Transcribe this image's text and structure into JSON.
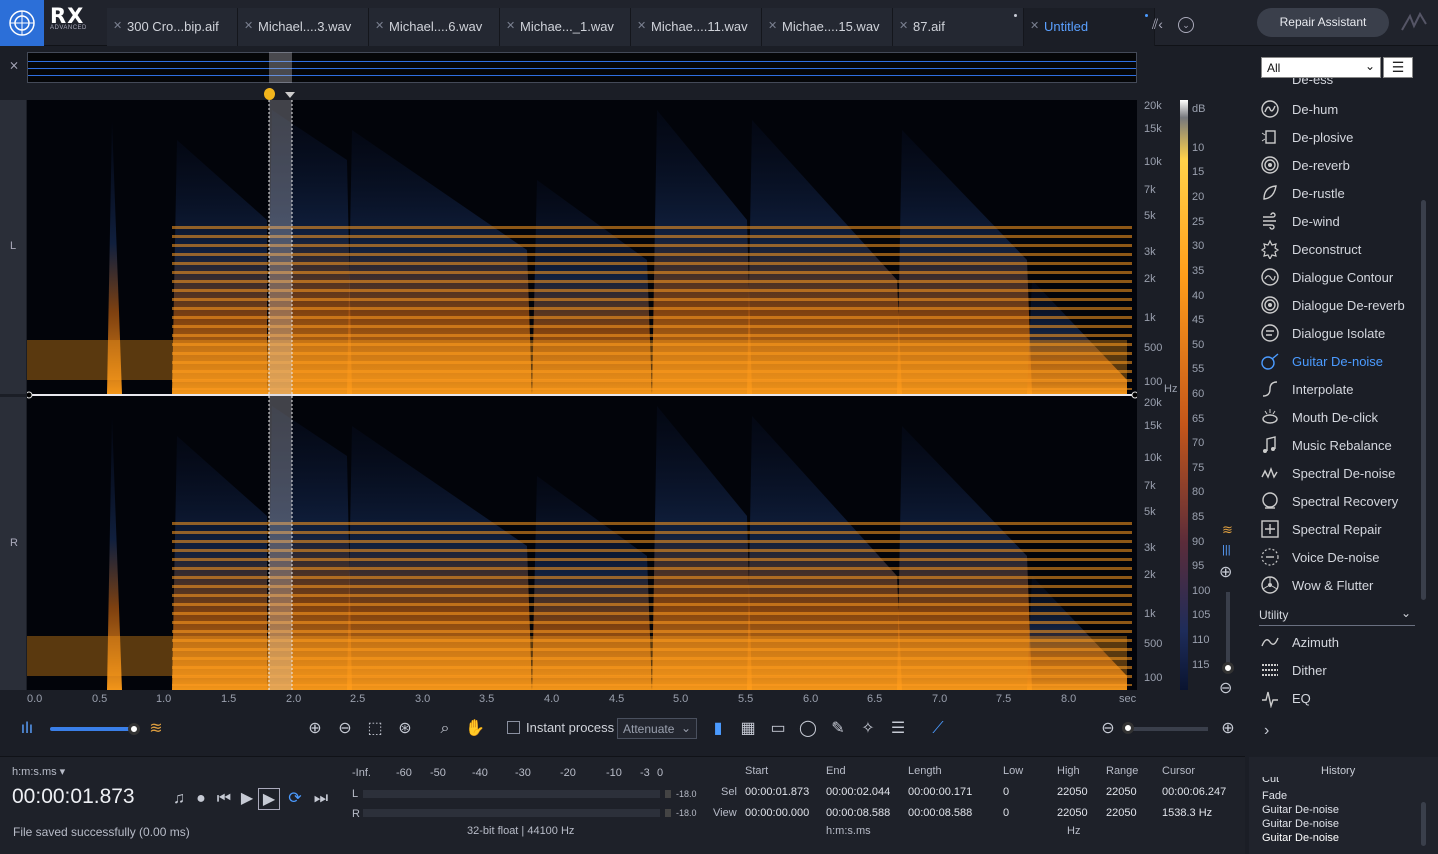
{
  "app": {
    "name": "RX",
    "edition": "ADVANCED"
  },
  "tabs": [
    {
      "label": "300 Cro...bip.aif"
    },
    {
      "label": "Michael....3.wav"
    },
    {
      "label": "Michael....6.wav"
    },
    {
      "label": "Michae..._1.wav"
    },
    {
      "label": "Michae....11.wav"
    },
    {
      "label": "Michae....15.wav"
    },
    {
      "label": "87.aif"
    },
    {
      "label": "Untitled"
    }
  ],
  "repair_assistant": "Repair Assistant",
  "channels": {
    "left": "L",
    "right": "R"
  },
  "freq_labels_top": [
    "20k",
    "15k",
    "10k",
    "7k",
    "5k",
    "3k",
    "2k",
    "1k",
    "500",
    "100",
    "Hz"
  ],
  "freq_labels_bottom": [
    "20k",
    "15k",
    "10k",
    "7k",
    "5k",
    "3k",
    "2k",
    "1k",
    "500",
    "100"
  ],
  "db_labels": [
    "dB",
    "10",
    "15",
    "20",
    "25",
    "30",
    "35",
    "40",
    "45",
    "50",
    "55",
    "60",
    "65",
    "70",
    "75",
    "80",
    "85",
    "90",
    "95",
    "100",
    "105",
    "110",
    "115"
  ],
  "time_labels": [
    "0.0",
    "0.5",
    "1.0",
    "1.5",
    "2.0",
    "2.5",
    "3.0",
    "3.5",
    "4.0",
    "4.5",
    "5.0",
    "5.5",
    "6.0",
    "6.5",
    "7.0",
    "7.5",
    "8.0",
    "sec"
  ],
  "toolbar": {
    "instant_process": "Instant process",
    "attenuate": "Attenuate"
  },
  "transport": {
    "time_format": "h:m:s.ms",
    "current_time": "00:00:01.873",
    "status": "File saved successfully (0.00 ms)"
  },
  "meter": {
    "scale": [
      "-Inf.",
      "-60",
      "-50",
      "-40",
      "-30",
      "-20",
      "-10",
      "-3",
      "0"
    ],
    "left": "L",
    "right": "R",
    "peak_l": "-18.0",
    "peak_r": "-18.0",
    "format": "32-bit float | 44100 Hz"
  },
  "selection": {
    "headers": {
      "start": "Start",
      "end": "End",
      "length": "Length",
      "low": "Low",
      "high": "High",
      "range": "Range",
      "cursor": "Cursor"
    },
    "sel": {
      "label": "Sel",
      "start": "00:00:01.873",
      "end": "00:00:02.044",
      "length": "00:00:00.171",
      "low": "0",
      "high": "22050",
      "range": "22050",
      "cursor": "00:00:06.247"
    },
    "view": {
      "label": "View",
      "start": "00:00:00.000",
      "end": "00:00:08.588",
      "length": "00:00:08.588",
      "low": "0",
      "high": "22050",
      "range": "22050",
      "cursor": "1538.3 Hz"
    },
    "time_unit": "h:m:s.ms",
    "freq_unit": "Hz"
  },
  "modules": {
    "filter": "All",
    "partial_top": "De-ess",
    "items": [
      "De-hum",
      "De-plosive",
      "De-reverb",
      "De-rustle",
      "De-wind",
      "Deconstruct",
      "Dialogue Contour",
      "Dialogue De-reverb",
      "Dialogue Isolate",
      "Guitar De-noise",
      "Interpolate",
      "Mouth De-click",
      "Music Rebalance",
      "Spectral De-noise",
      "Spectral Recovery",
      "Spectral Repair",
      "Voice De-noise",
      "Wow & Flutter"
    ],
    "selected": "Guitar De-noise",
    "utility_label": "Utility",
    "utility_items": [
      "Azimuth",
      "Dither",
      "EQ"
    ]
  },
  "history": {
    "title": "History",
    "items": [
      "Cut",
      "Fade",
      "Guitar De-noise",
      "Guitar De-noise",
      "Guitar De-noise"
    ]
  },
  "colors": {
    "accent": "#4b9bff",
    "logo": "#2c6fd8",
    "spectrum_hot": "#ff9d1a"
  }
}
